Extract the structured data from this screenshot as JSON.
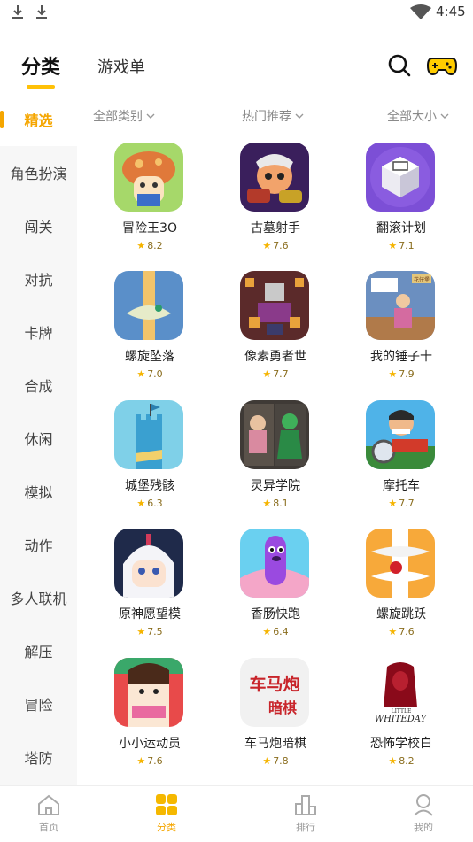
{
  "status_bar": {
    "time": "4:45"
  },
  "header": {
    "tabs": [
      {
        "label": "分类"
      },
      {
        "label": "游戏单"
      }
    ]
  },
  "sidebar": {
    "items": [
      {
        "label": "精选"
      },
      {
        "label": "角色扮演"
      },
      {
        "label": "闯关"
      },
      {
        "label": "对抗"
      },
      {
        "label": "卡牌"
      },
      {
        "label": "合成"
      },
      {
        "label": "休闲"
      },
      {
        "label": "模拟"
      },
      {
        "label": "动作"
      },
      {
        "label": "多人联机"
      },
      {
        "label": "解压"
      },
      {
        "label": "冒险"
      },
      {
        "label": "塔防"
      }
    ]
  },
  "filters": [
    {
      "label": "全部类别"
    },
    {
      "label": "热门推荐"
    },
    {
      "label": "全部大小"
    }
  ],
  "games": [
    {
      "name": "冒险王3O",
      "rating": "8.2"
    },
    {
      "name": "古墓射手",
      "rating": "7.6"
    },
    {
      "name": "翻滚计划",
      "rating": "7.1"
    },
    {
      "name": "螺旋坠落",
      "rating": "7.0"
    },
    {
      "name": "像素勇者世",
      "rating": "7.7"
    },
    {
      "name": "我的锤子十",
      "rating": "7.9"
    },
    {
      "name": "城堡残骸",
      "rating": "6.3"
    },
    {
      "name": "灵异学院",
      "rating": "8.1"
    },
    {
      "name": "摩托车",
      "rating": "7.7"
    },
    {
      "name": "原神愿望模",
      "rating": "7.5"
    },
    {
      "name": "香肠快跑",
      "rating": "6.4"
    },
    {
      "name": "螺旋跳跃",
      "rating": "7.6"
    },
    {
      "name": "小小运动员",
      "rating": "7.6"
    },
    {
      "name": "车马炮暗棋",
      "rating": "7.8"
    },
    {
      "name": "恐怖学校白",
      "rating": "8.2"
    }
  ],
  "icon_text": {
    "chess": [
      "车马炮",
      "暗棋"
    ],
    "wife": [
      "LITTLE",
      "WHITEDAY"
    ],
    "hammer_sign": "花仔堡"
  },
  "bottom_nav": [
    {
      "label": "首页"
    },
    {
      "label": "分类"
    },
    {
      "label": "排行"
    },
    {
      "label": "我的"
    }
  ],
  "colors": {
    "accent": "#f5a600",
    "indicator": "#ffc107"
  }
}
